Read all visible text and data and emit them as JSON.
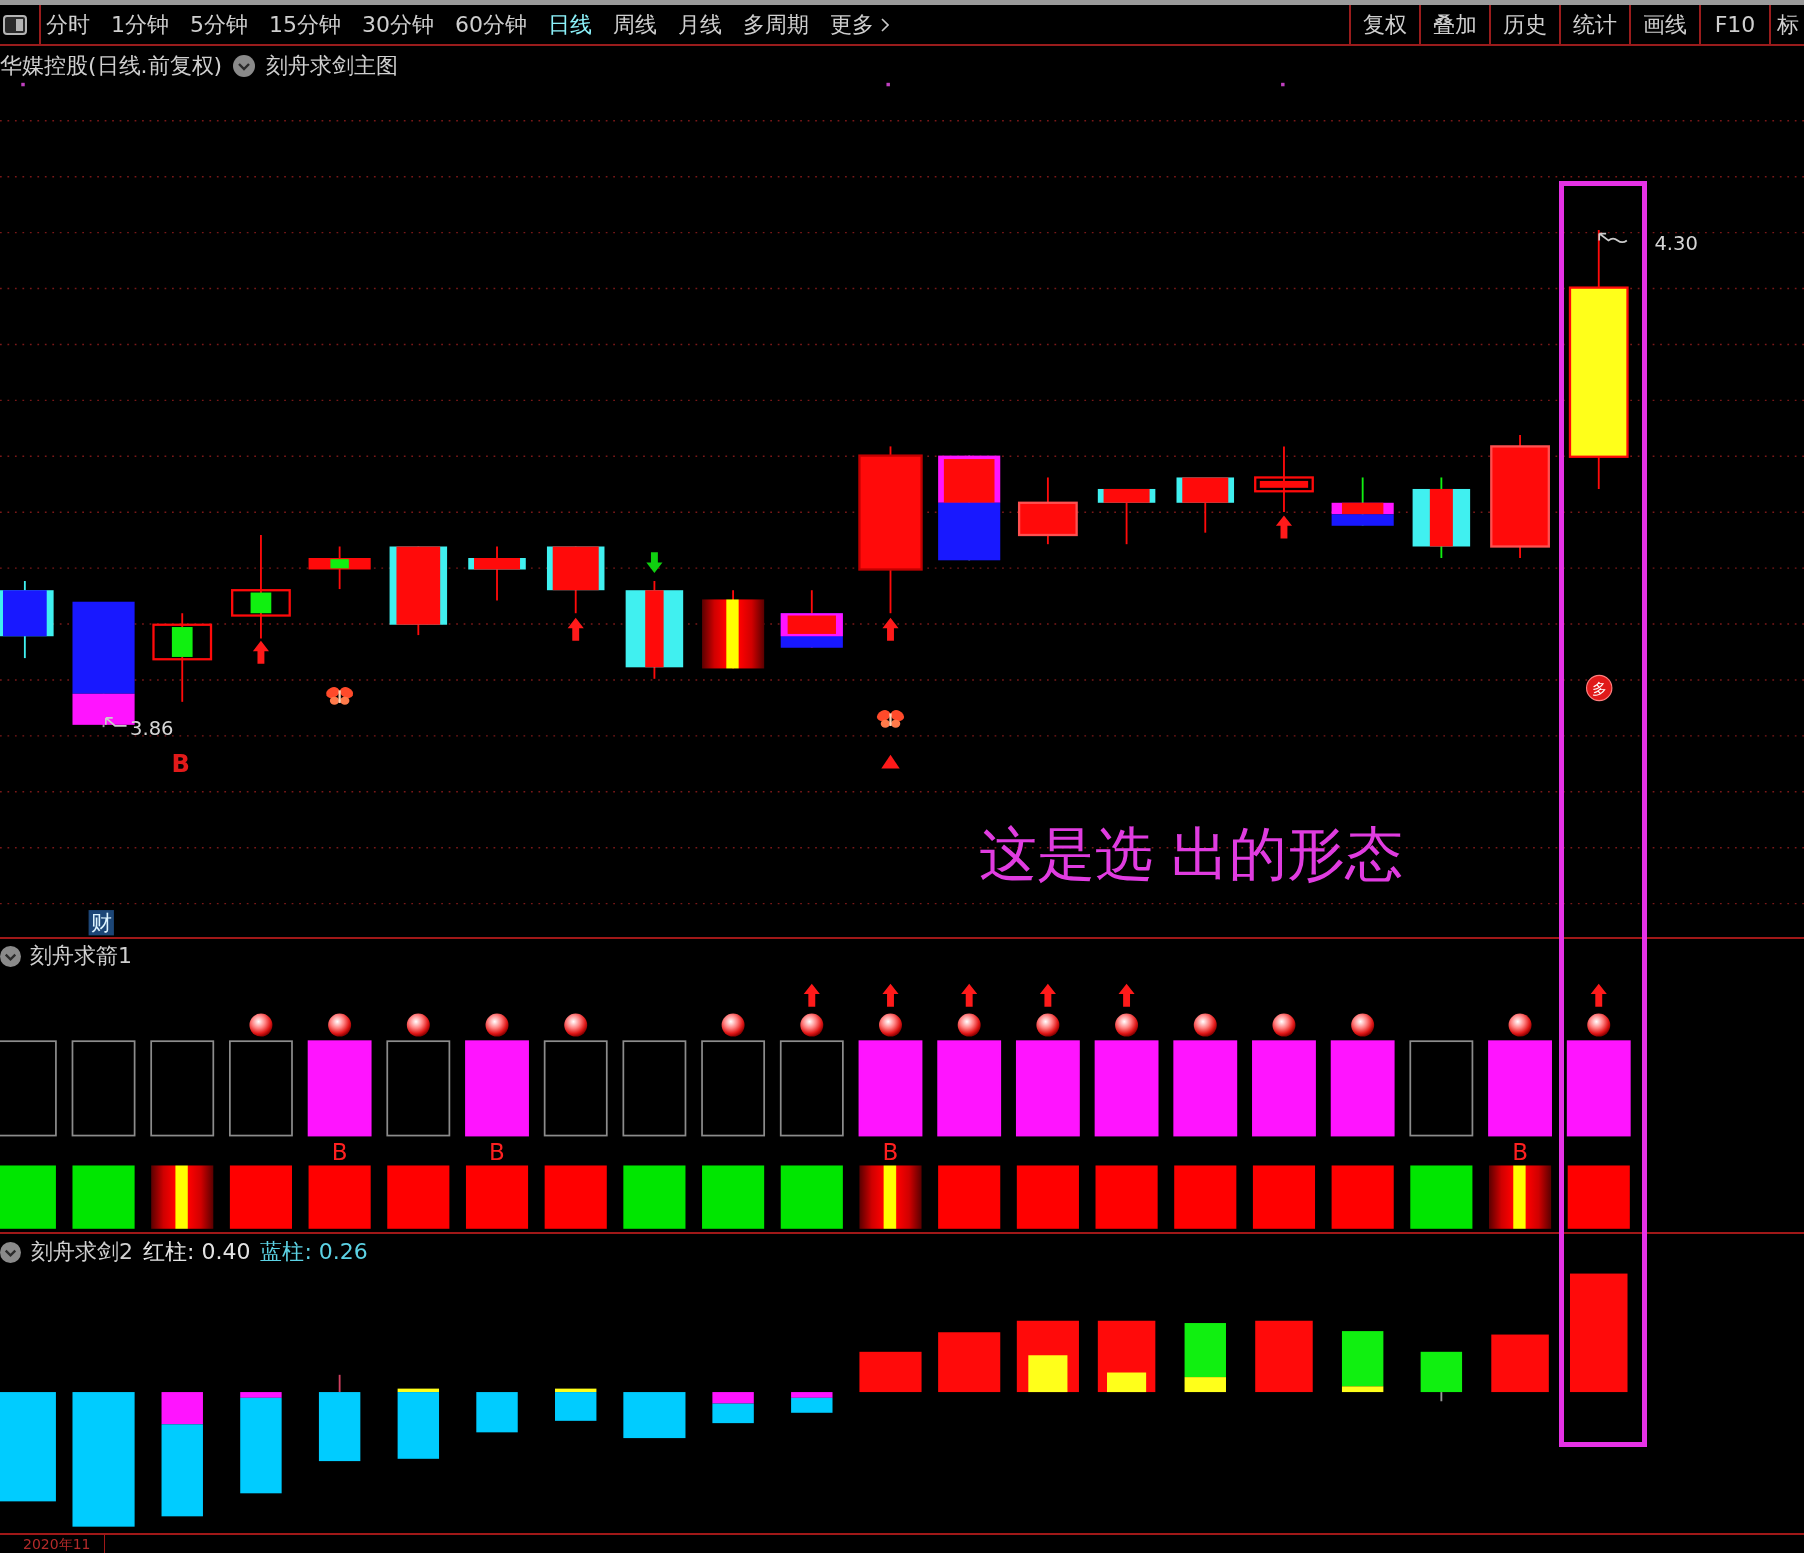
{
  "toolbar": {
    "periods": [
      {
        "label": "分时",
        "selected": false
      },
      {
        "label": "1分钟",
        "selected": false
      },
      {
        "label": "5分钟",
        "selected": false
      },
      {
        "label": "15分钟",
        "selected": false
      },
      {
        "label": "30分钟",
        "selected": false
      },
      {
        "label": "60分钟",
        "selected": false
      },
      {
        "label": "日线",
        "selected": true
      },
      {
        "label": "周线",
        "selected": false
      },
      {
        "label": "月线",
        "selected": false
      },
      {
        "label": "多周期",
        "selected": false
      }
    ],
    "more": "更多",
    "tools": [
      "复权",
      "叠加",
      "历史",
      "统计",
      "画线",
      "F10",
      "标"
    ]
  },
  "main_chart": {
    "title": "华媒控股(日线.前复权)",
    "indicator": "刻舟求剑主图",
    "high_label": "4.30",
    "low_label": "3.86",
    "buy_mark": "B",
    "signal_badge": "多",
    "finance_badge": "财",
    "annotation": "这是选 出的形态"
  },
  "signal_panel": {
    "title": "刻舟求箭1",
    "columns": [
      {
        "ball": false,
        "arrow": false,
        "filled": false,
        "bar": {
          "kind": "solid",
          "color": "#00e600"
        }
      },
      {
        "ball": false,
        "arrow": false,
        "filled": false,
        "bar": {
          "kind": "solid",
          "color": "#00e600"
        }
      },
      {
        "ball": false,
        "arrow": false,
        "filled": false,
        "bar": {
          "kind": "striped"
        }
      },
      {
        "ball": true,
        "arrow": false,
        "filled": false,
        "bar": {
          "kind": "solid",
          "color": "#ff0000"
        }
      },
      {
        "ball": true,
        "arrow": false,
        "filled": true,
        "mark": "B",
        "bar": {
          "kind": "solid",
          "color": "#ff0000"
        }
      },
      {
        "ball": true,
        "arrow": false,
        "filled": false,
        "bar": {
          "kind": "solid",
          "color": "#ff0000"
        }
      },
      {
        "ball": true,
        "arrow": false,
        "filled": true,
        "mark": "B",
        "bar": {
          "kind": "solid",
          "color": "#ff0000"
        }
      },
      {
        "ball": true,
        "arrow": false,
        "filled": false,
        "bar": {
          "kind": "solid",
          "color": "#ff0000"
        }
      },
      {
        "ball": false,
        "arrow": false,
        "filled": false,
        "bar": {
          "kind": "solid",
          "color": "#00e600"
        }
      },
      {
        "ball": true,
        "arrow": false,
        "filled": false,
        "bar": {
          "kind": "solid",
          "color": "#00e600"
        }
      },
      {
        "ball": true,
        "arrow": true,
        "filled": false,
        "bar": {
          "kind": "solid",
          "color": "#00e600"
        }
      },
      {
        "ball": true,
        "arrow": true,
        "filled": true,
        "mark": "B",
        "bar": {
          "kind": "striped"
        }
      },
      {
        "ball": true,
        "arrow": true,
        "filled": true,
        "bar": {
          "kind": "solid",
          "color": "#ff0000"
        }
      },
      {
        "ball": true,
        "arrow": true,
        "filled": true,
        "bar": {
          "kind": "solid",
          "color": "#ff0000"
        }
      },
      {
        "ball": true,
        "arrow": true,
        "filled": true,
        "bar": {
          "kind": "solid",
          "color": "#ff0000"
        }
      },
      {
        "ball": true,
        "arrow": false,
        "filled": true,
        "bar": {
          "kind": "solid",
          "color": "#ff0000"
        }
      },
      {
        "ball": true,
        "arrow": false,
        "filled": true,
        "bar": {
          "kind": "solid",
          "color": "#ff0000"
        }
      },
      {
        "ball": true,
        "arrow": false,
        "filled": true,
        "bar": {
          "kind": "solid",
          "color": "#ff0000"
        }
      },
      {
        "ball": false,
        "arrow": false,
        "filled": false,
        "bar": {
          "kind": "solid",
          "color": "#00e600"
        }
      },
      {
        "ball": true,
        "arrow": false,
        "filled": true,
        "mark": "B",
        "bar": {
          "kind": "striped"
        }
      },
      {
        "ball": true,
        "arrow": true,
        "filled": true,
        "bar": {
          "kind": "solid",
          "color": "#ff0000"
        }
      }
    ]
  },
  "histogram_panel": {
    "title": "刻舟求剑2",
    "readings": [
      {
        "text": "红柱: 0.40",
        "color": "#e4e4e4"
      },
      {
        "text": "蓝柱: 0.26",
        "color": "#5cd2e4"
      }
    ]
  },
  "x_axis": {
    "label": "2020年11"
  }
}
